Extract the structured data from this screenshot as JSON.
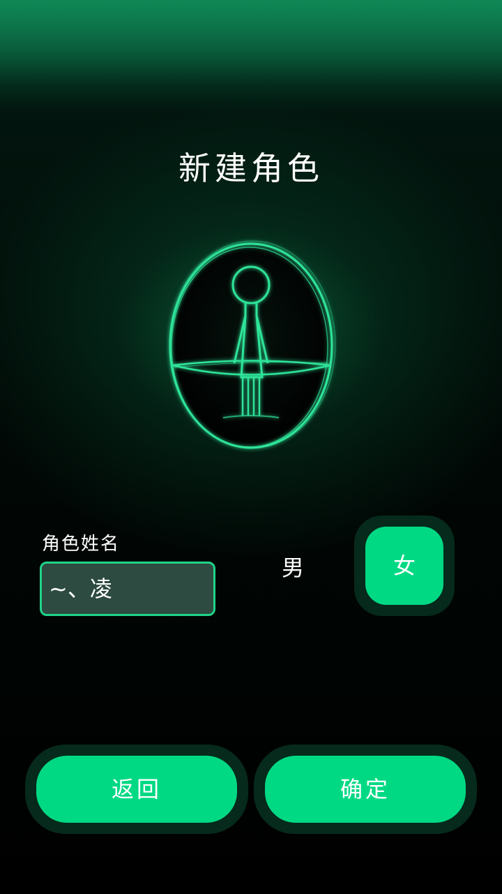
{
  "title": "新建角色",
  "form": {
    "name_label": "角色姓名",
    "name_value": "~、凌"
  },
  "gender": {
    "male_label": "男",
    "female_label": "女",
    "selected": "女"
  },
  "buttons": {
    "back_label": "返回",
    "confirm_label": "确定"
  },
  "colors": {
    "accent": "#00d984",
    "accent_outline": "#1fd48a",
    "input_bg": "#2d4b40",
    "button_shadow": "#062a1c"
  },
  "icons": {
    "portrait": "stick-figure-in-oval-icon"
  }
}
